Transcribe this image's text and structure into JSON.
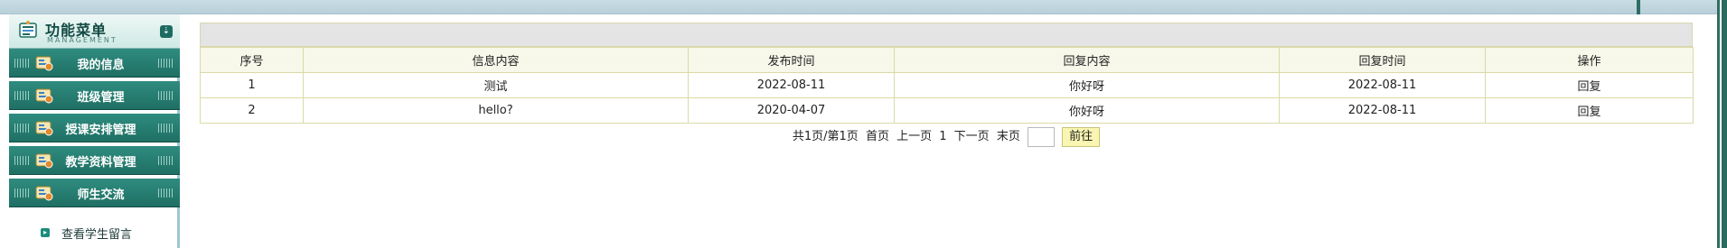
{
  "sidebar": {
    "title": "功能菜单",
    "subtitle": "MANAGEMENT",
    "collapse_icon": "double-chevron-down-icon",
    "items": [
      {
        "label": "我的信息",
        "icon": "user-card-icon"
      },
      {
        "label": "班级管理",
        "icon": "user-card-icon"
      },
      {
        "label": "授课安排管理",
        "icon": "user-card-icon"
      },
      {
        "label": "教学资料管理",
        "icon": "user-card-icon"
      },
      {
        "label": "师生交流",
        "icon": "user-card-icon"
      }
    ],
    "sub_items": [
      {
        "label": "查看学生留言",
        "icon": "arrow-right-icon"
      }
    ]
  },
  "table": {
    "columns": [
      "序号",
      "信息内容",
      "发布时间",
      "回复内容",
      "回复时间",
      "操作"
    ],
    "rows": [
      [
        "1",
        "测试",
        "2022-08-11",
        "你好呀",
        "2022-08-11",
        "回复"
      ],
      [
        "2",
        "hello?",
        "2020-04-07",
        "你好呀",
        "2022-08-11",
        "回复"
      ]
    ]
  },
  "pager": {
    "summary": "共1页/第1页",
    "first": "首页",
    "prev": "上一页",
    "current": "1",
    "next": "下一页",
    "last": "末页",
    "go_label": "前往",
    "page_input_value": ""
  },
  "colors": {
    "menu_bg": "#1f6f64",
    "header_row_bg": "#f7f7ea",
    "grid_border": "#dadaa8",
    "go_button_bg": "#f9f6b2"
  }
}
